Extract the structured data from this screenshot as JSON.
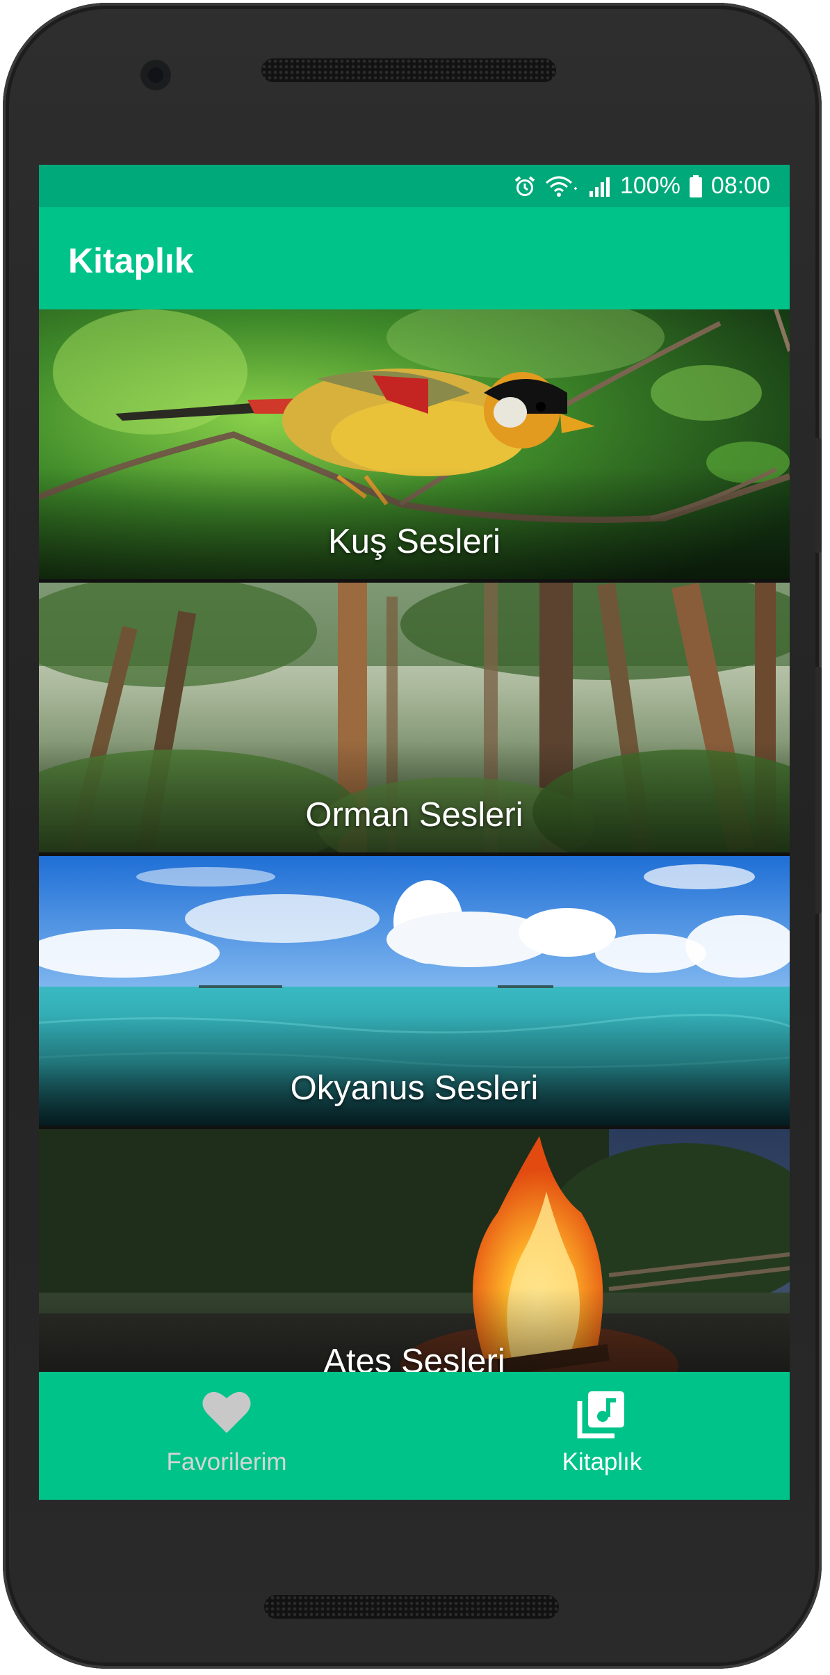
{
  "status_bar": {
    "battery": "100%",
    "time": "08:00",
    "icons": [
      "alarm-icon",
      "wifi-icon",
      "cell-signal-icon",
      "battery-icon"
    ]
  },
  "app_bar": {
    "title": "Kitaplık"
  },
  "categories": [
    {
      "label": "Kuş Sesleri",
      "image": "bird-on-branch"
    },
    {
      "label": "Orman Sesleri",
      "image": "misty-forest"
    },
    {
      "label": "Okyanus Sesleri",
      "image": "ocean-with-clouds"
    },
    {
      "label": "Ateş Sesleri",
      "image": "campfire-in-field"
    }
  ],
  "bottom_nav": {
    "items": [
      {
        "label": "Favorilerim",
        "icon": "heart-icon",
        "active": false
      },
      {
        "label": "Kitaplık",
        "icon": "music-library-icon",
        "active": true
      }
    ]
  },
  "colors": {
    "primary": "#00c389",
    "primary_dark": "#00a979",
    "nav_inactive": "#c8c8c8",
    "nav_active": "#ffffff"
  }
}
